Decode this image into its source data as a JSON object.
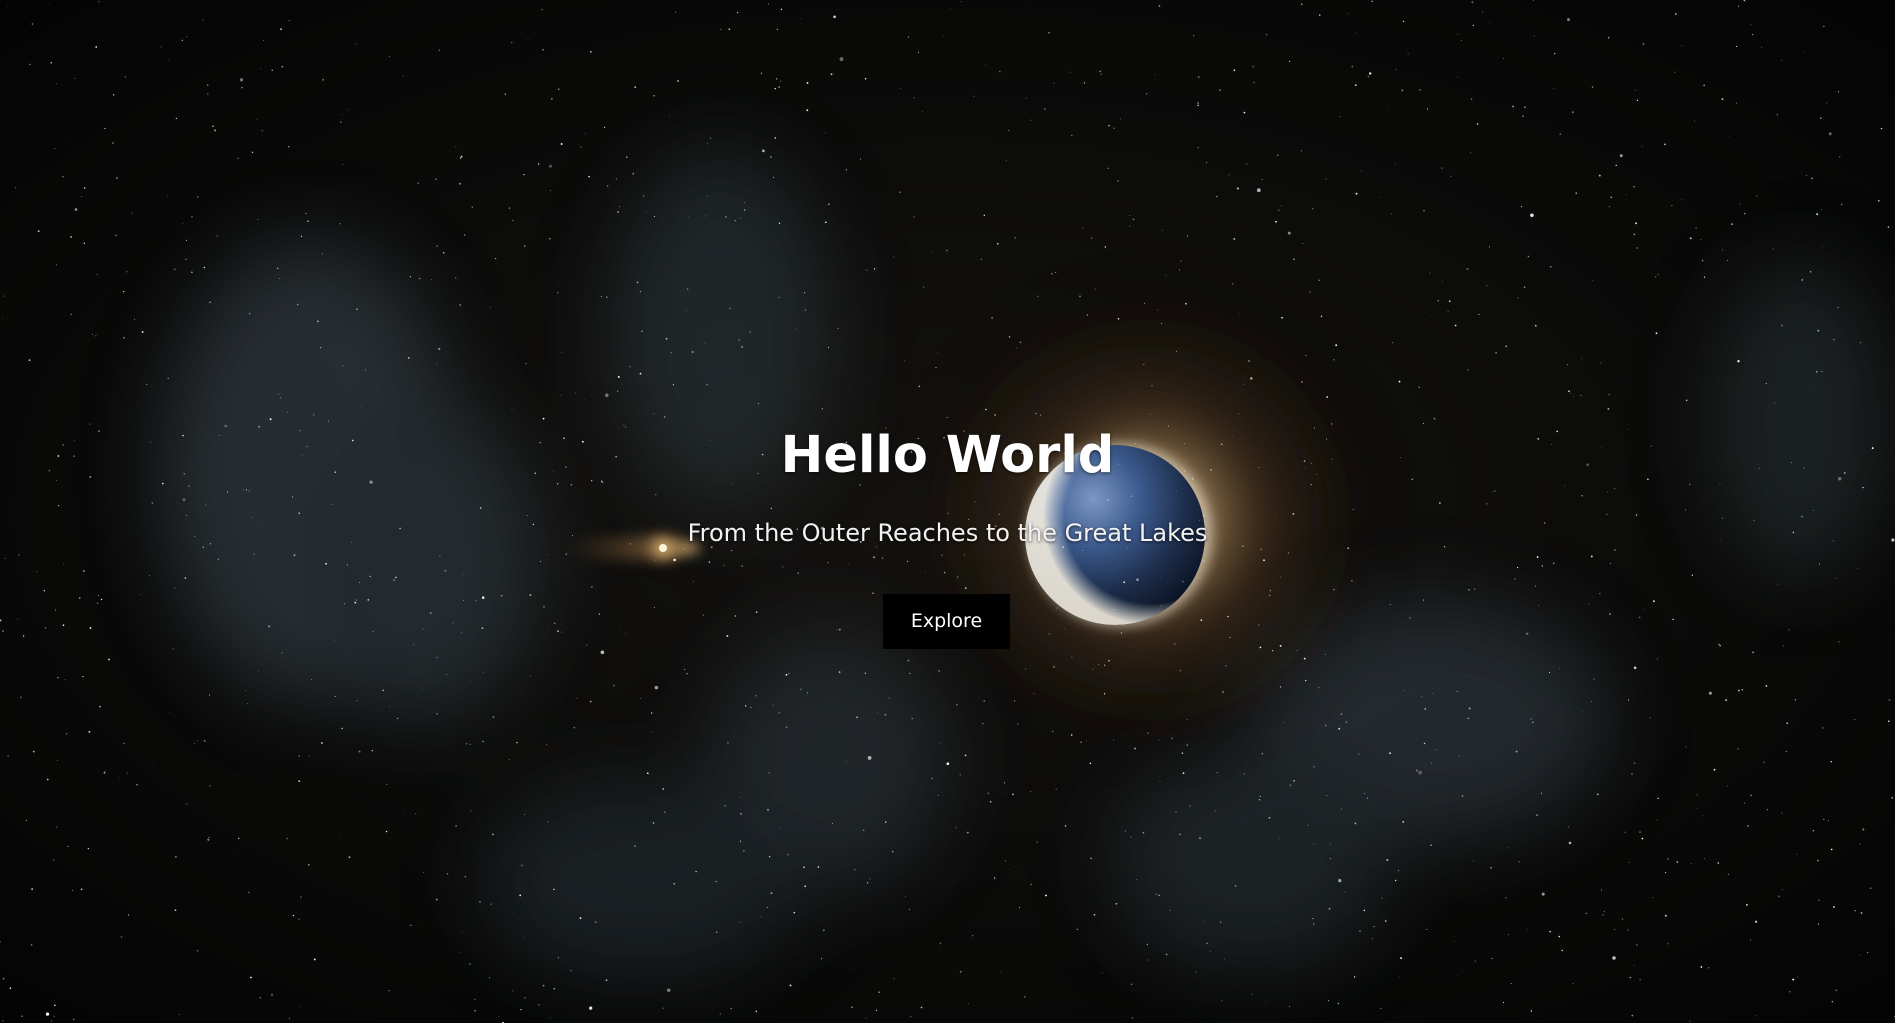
{
  "hero": {
    "title": "Hello World",
    "subtitle": "From the Outer Reaches to the Great Lakes",
    "cta_label": "Explore"
  },
  "colors": {
    "background": "#070707",
    "text": "#ffffff",
    "button_bg": "#000000",
    "glow": "#f3c98b",
    "planet": "#3b5b8f"
  }
}
